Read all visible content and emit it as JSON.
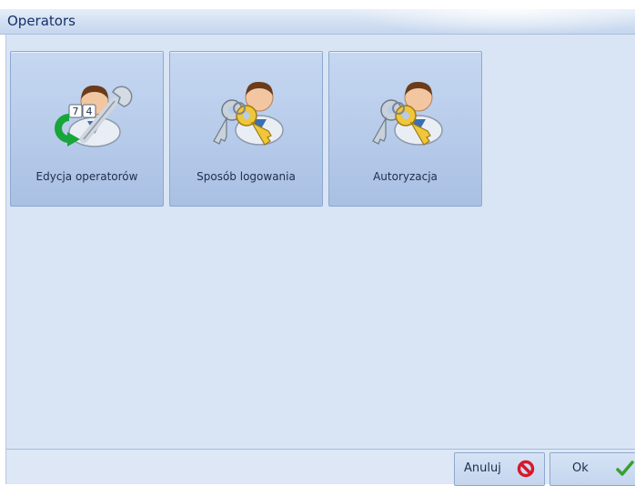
{
  "window": {
    "title": "Operators"
  },
  "tiles": [
    {
      "label": "Edycja operatorów",
      "icon": "operator-edit-icon"
    },
    {
      "label": "Sposób logowania",
      "icon": "operator-keys-icon"
    },
    {
      "label": "Autoryzacja",
      "icon": "operator-keys-icon"
    }
  ],
  "footer": {
    "cancel_label": "Anuluj",
    "ok_label": "Ok"
  },
  "colors": {
    "title_text": "#15316b",
    "content_bg": "#d9e5f4",
    "tile_bg": "#b7cbea",
    "cancel_icon": "#d8182a",
    "ok_icon": "#3aa02e"
  }
}
